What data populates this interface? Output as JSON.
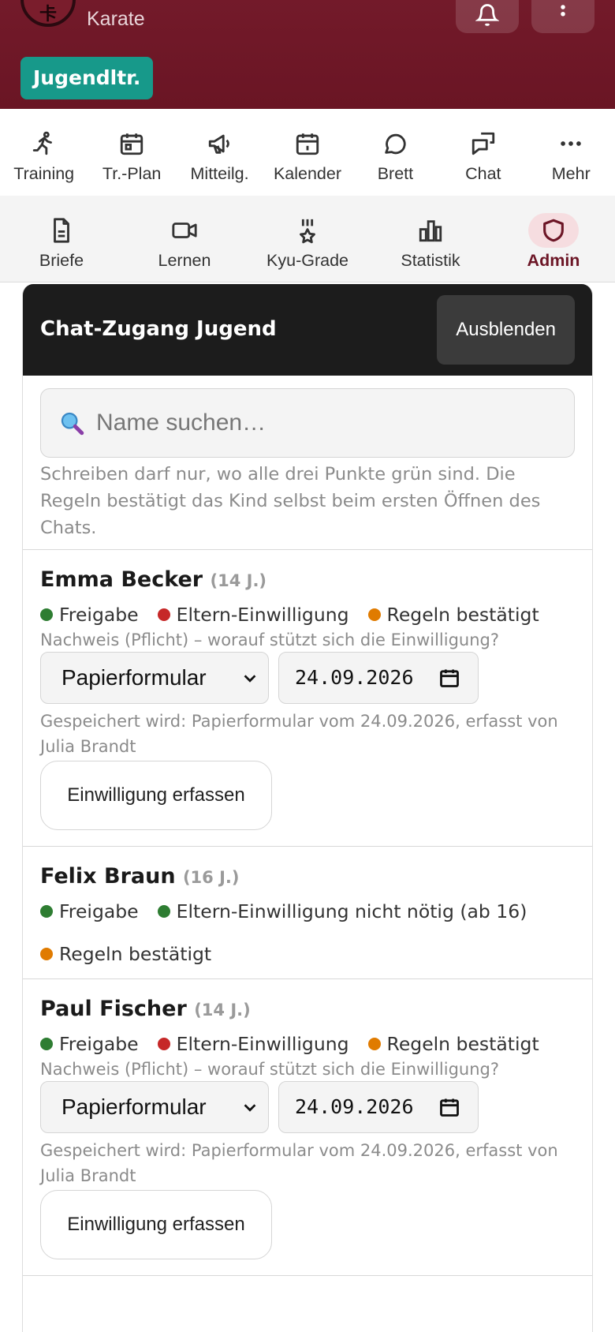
{
  "header": {
    "app_subtitle": "Karate",
    "role_badge": "Jugendltr.",
    "logo_icon": "club-logo",
    "bell_icon": "bell-icon",
    "menu_icon": "more-vertical-icon"
  },
  "nav_primary": [
    {
      "label": "Training",
      "icon": "running-icon"
    },
    {
      "label": "Tr.-Plan",
      "icon": "calendar-plan-icon"
    },
    {
      "label": "Mitteilg.",
      "icon": "megaphone-icon"
    },
    {
      "label": "Kalender",
      "icon": "calendar-icon"
    },
    {
      "label": "Brett",
      "icon": "speech-bubble-icon"
    },
    {
      "label": "Chat",
      "icon": "chat-icon"
    },
    {
      "label": "Mehr",
      "icon": "more-horizontal-icon"
    }
  ],
  "nav_secondary": [
    {
      "label": "Briefe",
      "icon": "document-icon"
    },
    {
      "label": "Lernen",
      "icon": "video-icon"
    },
    {
      "label": "Kyu-Grade",
      "icon": "medal-icon"
    },
    {
      "label": "Statistik",
      "icon": "bar-chart-icon"
    },
    {
      "label": "Admin",
      "icon": "shield-icon",
      "active": true
    }
  ],
  "panel": {
    "title": "Chat-Zugang Jugend",
    "hide_label": "Ausblenden",
    "search_placeholder": "Name suchen…",
    "hint": "Schreiben darf nur, wo alle drei Punkte grün sind. Die Regeln bestätigt das Kind selbst beim ersten Öffnen des Chats."
  },
  "colors": {
    "header_bg": "#731a2a",
    "badge_bg": "#17998a",
    "dot_green": "#2e7d32",
    "dot_red": "#c62828",
    "dot_orange": "#e07b00",
    "active_nav": "#6c1626"
  },
  "members": [
    {
      "name": "Emma Becker",
      "age": "(14 J.)",
      "statuses": [
        {
          "label": "Freigabe",
          "color": "green"
        },
        {
          "label": "Eltern-Einwilligung",
          "color": "red"
        },
        {
          "label": "Regeln bestätigt",
          "color": "orange"
        }
      ],
      "proof_label": "Nachweis (Pflicht) – worauf stützt sich die Einwilligung?",
      "proof_select": "Papierformular",
      "proof_date": "24.09.2026",
      "saved_note": "Gespeichert wird: Papierformular vom 24.09.2026, erfasst von Julia Brandt",
      "button": "Einwilligung erfassen"
    },
    {
      "name": "Felix Braun",
      "age": "(16 J.)",
      "statuses": [
        {
          "label": "Freigabe",
          "color": "green"
        },
        {
          "label": "Eltern-Einwilligung nicht nötig (ab 16)",
          "color": "green"
        },
        {
          "label": "Regeln bestätigt",
          "color": "orange"
        }
      ]
    },
    {
      "name": "Paul Fischer",
      "age": "(14 J.)",
      "statuses": [
        {
          "label": "Freigabe",
          "color": "green"
        },
        {
          "label": "Eltern-Einwilligung",
          "color": "red"
        },
        {
          "label": "Regeln bestätigt",
          "color": "orange"
        }
      ],
      "proof_label": "Nachweis (Pflicht) – worauf stützt sich die Einwilligung?",
      "proof_select": "Papierformular",
      "proof_date": "24.09.2026",
      "saved_note": "Gespeichert wird: Papierformular vom 24.09.2026, erfasst von Julia Brandt",
      "button": "Einwilligung erfassen"
    }
  ]
}
